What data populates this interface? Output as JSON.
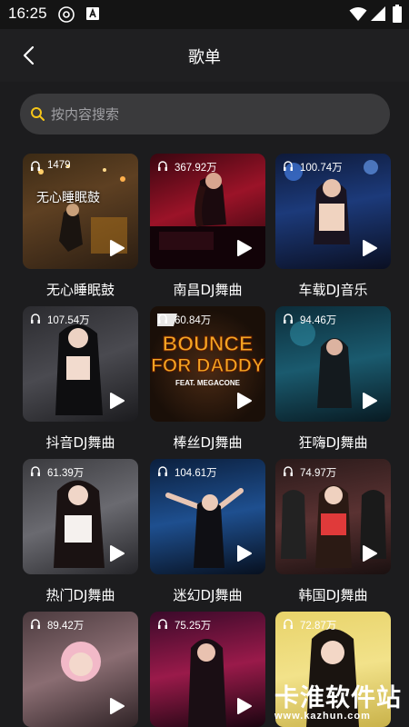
{
  "status_bar": {
    "time": "16:25"
  },
  "header": {
    "title": "歌单"
  },
  "search": {
    "placeholder": "按内容搜索"
  },
  "playlists": [
    {
      "name": "无心睡眠鼓",
      "play_count": "1479",
      "overlay_text": "无心睡眠鼓"
    },
    {
      "name": "南昌DJ舞曲",
      "play_count": "367.92万"
    },
    {
      "name": "车载DJ音乐",
      "play_count": "100.74万"
    },
    {
      "name": "抖音DJ舞曲",
      "play_count": "107.54万"
    },
    {
      "name": "棒丝DJ舞曲",
      "play_count": "60.84万",
      "cover_text": [
        "BOUNCE",
        "FOR DADDY",
        "FEAT. MEGACONE"
      ]
    },
    {
      "name": "狂嗨DJ舞曲",
      "play_count": "94.46万"
    },
    {
      "name": "热门DJ舞曲",
      "play_count": "61.39万"
    },
    {
      "name": "迷幻DJ舞曲",
      "play_count": "104.61万"
    },
    {
      "name": "韩国DJ舞曲",
      "play_count": "74.97万"
    },
    {
      "name": "",
      "play_count": "89.42万"
    },
    {
      "name": "",
      "play_count": "75.25万"
    },
    {
      "name": "",
      "play_count": "72.87万"
    }
  ],
  "watermark": {
    "title": "卡淮软件站",
    "url": "www.kazhun.com"
  },
  "colors": {
    "background": "#1c1c1e",
    "search_icon": "#f5c518",
    "search_bg": "#3a3a3c"
  }
}
